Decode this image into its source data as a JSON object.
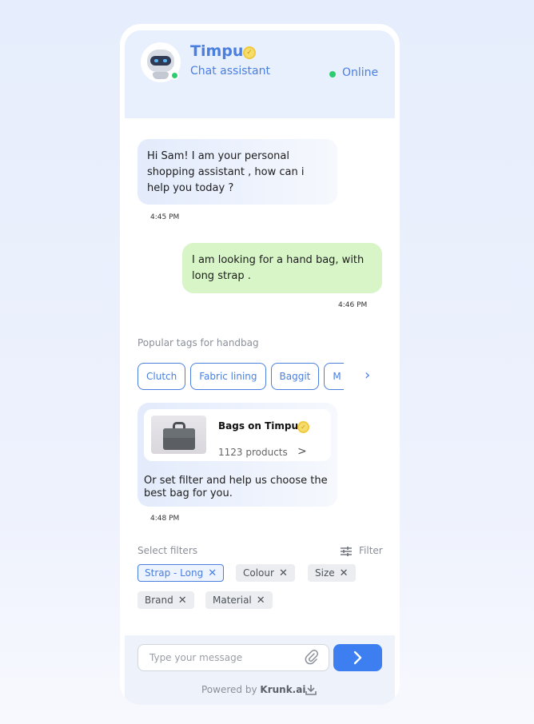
{
  "header": {
    "bot_name": "Timpu",
    "bot_role": "Chat assistant",
    "status": "Online"
  },
  "messages": [
    {
      "from": "bot",
      "text": "Hi Sam! I am your personal shopping assistant , how can i help you today ?",
      "time": "4:45 PM"
    },
    {
      "from": "user",
      "text": "I am looking for a hand bag, with long strap .",
      "time": "4:46 PM"
    }
  ],
  "tags": {
    "title": "Popular tags for handbag",
    "items": [
      "Clutch",
      "Fabric lining",
      "Baggit",
      "M"
    ]
  },
  "product": {
    "title": "Bags on Timpu",
    "count": "1123 products",
    "prompt": "Or set filter and help us choose the best bag for you.",
    "time": "4:48 PM"
  },
  "filters": {
    "title": "Select filters",
    "button_label": "Filter",
    "chips": [
      {
        "label": "Strap - Long",
        "active": true
      },
      {
        "label": "Colour",
        "active": false
      },
      {
        "label": "Size",
        "active": false
      },
      {
        "label": "Brand",
        "active": false
      },
      {
        "label": "Material",
        "active": false
      }
    ]
  },
  "composer": {
    "placeholder": "Type your message"
  },
  "footer": {
    "powered_prefix": "Powered by",
    "brand": "Krunk.ai"
  },
  "colors": {
    "accent": "#4a7fe0",
    "send_button": "#3d7ef0",
    "user_bubble": "#d8f5c8",
    "online": "#2ecc71"
  }
}
